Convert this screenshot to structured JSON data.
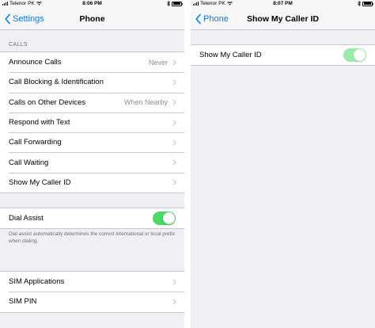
{
  "colors": {
    "accent": "#007aff",
    "toggle_on": "#4cd964",
    "background": "#efeff4"
  },
  "left": {
    "status": {
      "carrier": "Telenor PK",
      "time": "8:06 PM"
    },
    "nav": {
      "back_label": "Settings",
      "title": "Phone"
    },
    "calls_header": "CALLS",
    "calls_group": [
      {
        "label": "Announce Calls",
        "value": "Never"
      },
      {
        "label": "Call Blocking & Identification",
        "value": ""
      },
      {
        "label": "Calls on Other Devices",
        "value": "When Nearby"
      },
      {
        "label": "Respond with Text",
        "value": ""
      },
      {
        "label": "Call Forwarding",
        "value": ""
      },
      {
        "label": "Call Waiting",
        "value": ""
      },
      {
        "label": "Show My Caller ID",
        "value": ""
      }
    ],
    "dial_assist": {
      "label": "Dial Assist",
      "enabled": true
    },
    "dial_assist_footer": "Dial assist automatically determines the correct international or local prefix when dialing.",
    "sim_group": [
      {
        "label": "SIM Applications"
      },
      {
        "label": "SIM PIN"
      }
    ]
  },
  "right": {
    "status": {
      "carrier": "Telenor PK",
      "time": "8:07 PM"
    },
    "nav": {
      "back_label": "Phone",
      "title": "Show My Caller ID"
    },
    "caller_id": {
      "label": "Show My Caller ID",
      "enabled": true,
      "disabled_appearance": true
    }
  }
}
